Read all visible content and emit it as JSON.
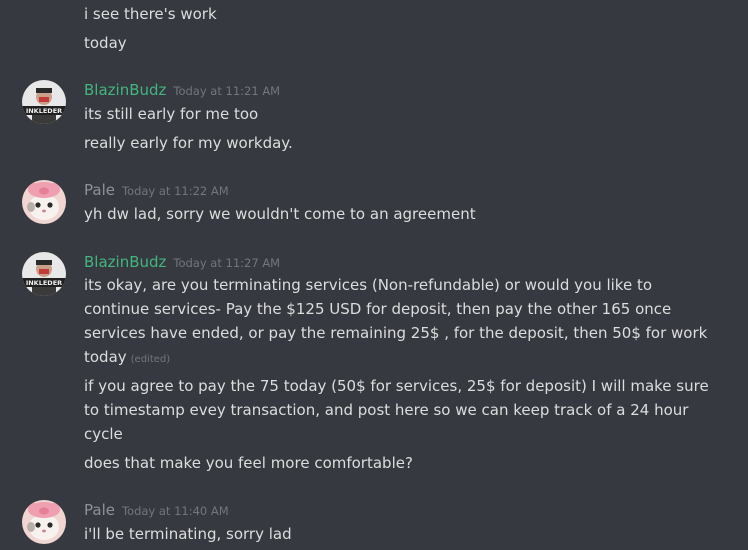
{
  "messages": {
    "prev_line1": "i see there's work",
    "prev_line2": "today",
    "m1": {
      "author": "BlazinBudz",
      "timestamp": "Today at 11:21 AM",
      "lines": [
        "its still early for me too",
        "really early for my workday."
      ]
    },
    "m2": {
      "author": "Pale",
      "timestamp": "Today at 11:22 AM",
      "lines": [
        "yh dw lad, sorry we wouldn't come to an agreement"
      ]
    },
    "m3": {
      "author": "BlazinBudz",
      "timestamp": "Today at 11:27 AM",
      "lines": [
        "its okay, are you terminating services (Non-refundable) or would you like to",
        "continue services- Pay the $125 USD for deposit, then pay  the other 165 once",
        "services have ended, or pay the remaining 25$ , for the deposit, then 50$ for work",
        "today",
        "if you agree to pay the 75 today (50$ for services, 25$ for deposit) I will make sure",
        "to timestamp evey transaction, and post here so we can keep track of a 24 hour",
        "cycle",
        "does that make you feel more comfortable?"
      ],
      "edited": "(edited)"
    },
    "m4": {
      "author": "Pale",
      "timestamp": "Today at 11:40 AM",
      "lines": [
        "i'll be terminating, sorry lad"
      ]
    }
  },
  "avatars": {
    "blazinbudz_text": "INKLEDER"
  },
  "colors": {
    "background": "#36393f",
    "text": "#dcddde",
    "author_green": "#43b581",
    "author_grey": "#8e9297",
    "timestamp": "#72767d"
  }
}
